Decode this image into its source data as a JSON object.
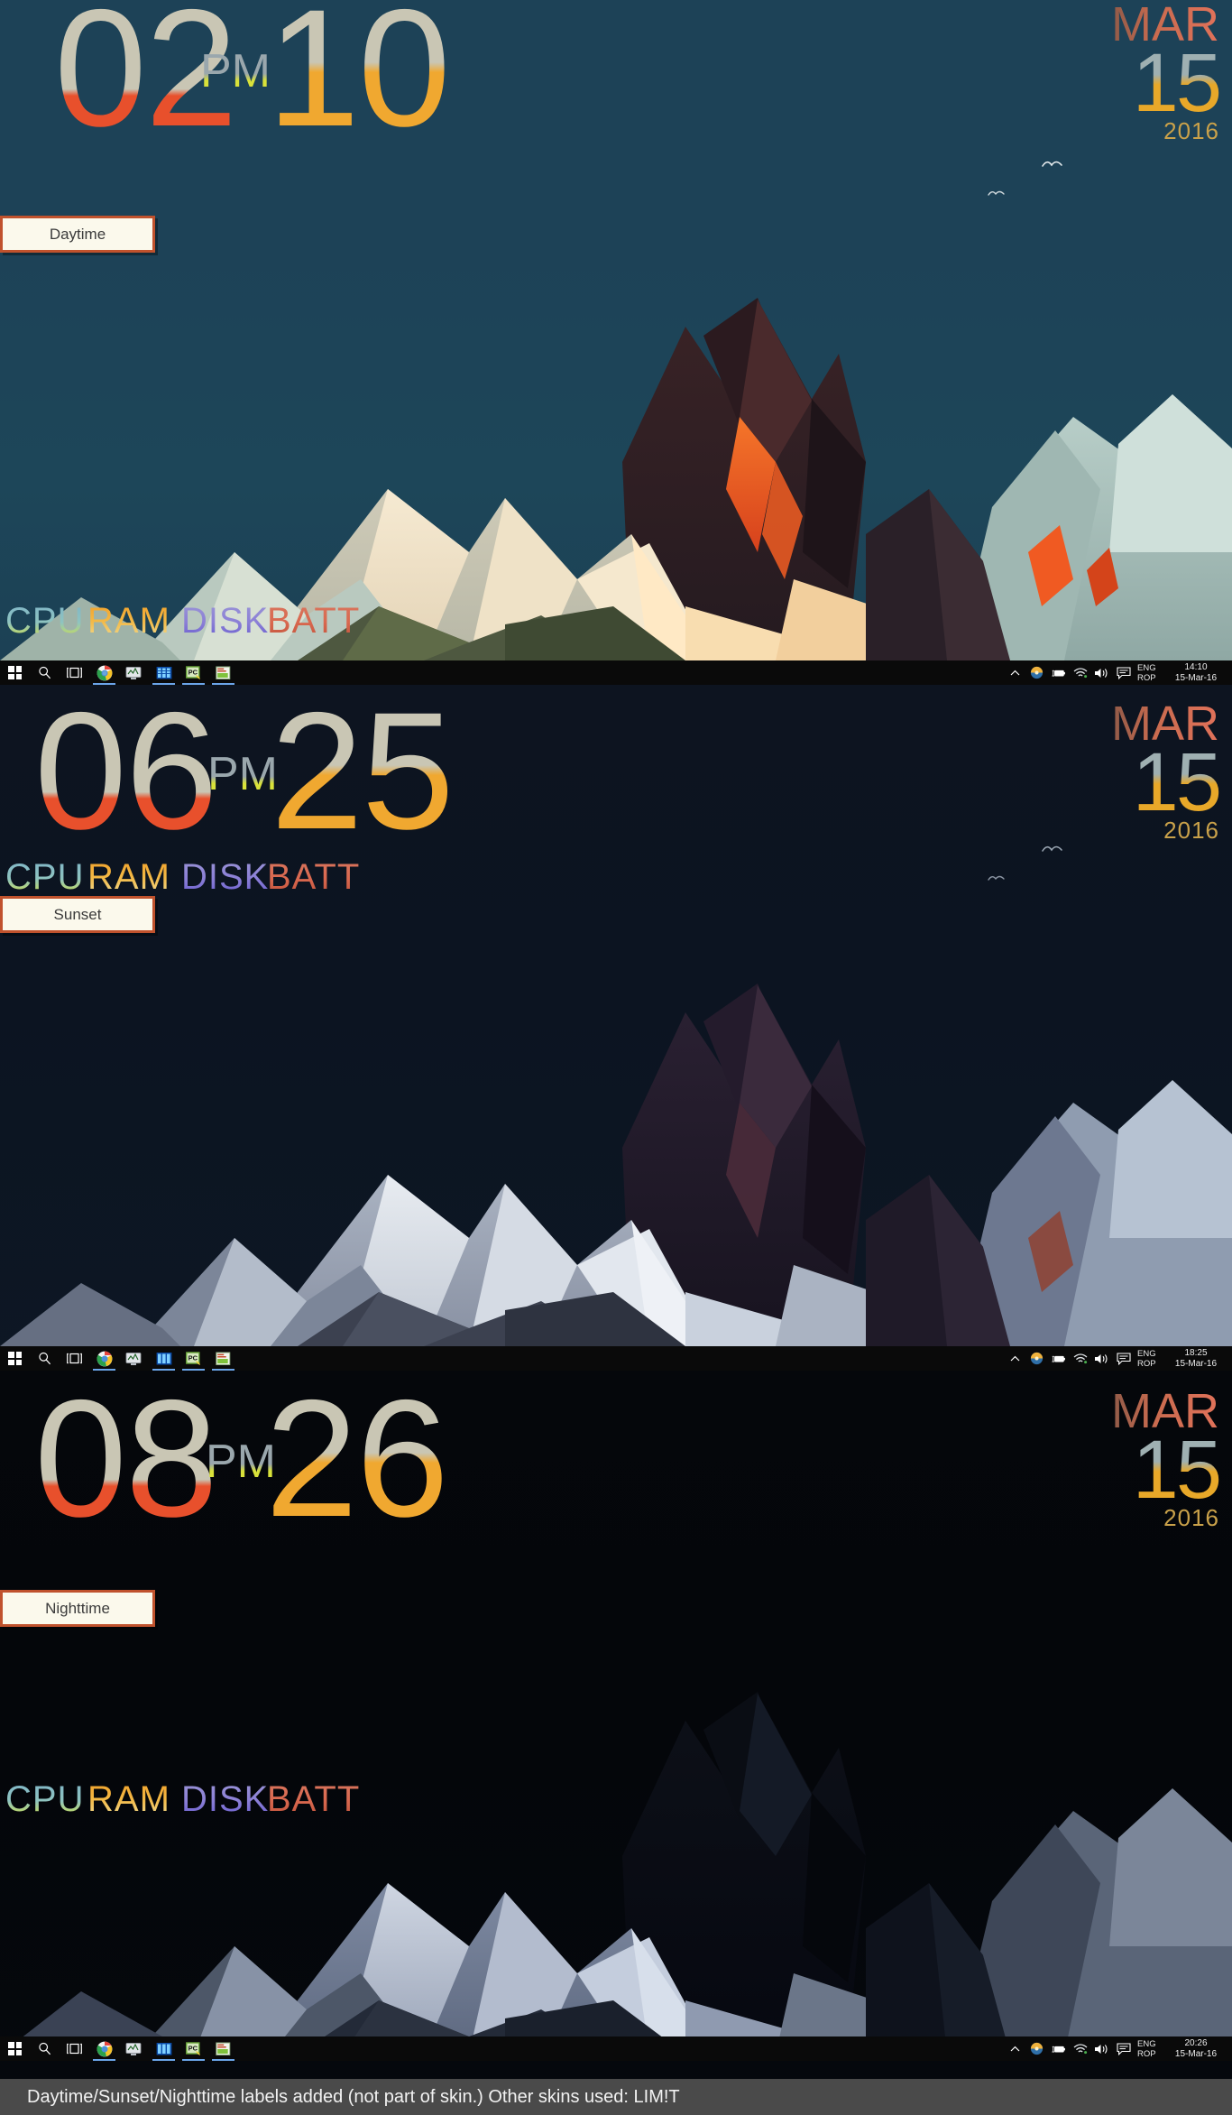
{
  "caption": {
    "text": "Daytime/Sunset/Nighttime labels added (not part of skin.) Other skins used: LIM!T"
  },
  "colors": {
    "accent_red": "#e8502c",
    "accent_gold": "#f0a830",
    "accent_cream": "#c9c6b4",
    "accent_yellow": "#d9e23a",
    "accent_purple": "#8b7fd6",
    "label_border": "#c0522d",
    "label_bg": "#fbf9ec",
    "sky_day": "#1d4257",
    "sky_sunset": "#0d1420",
    "sky_night": "#05070b"
  },
  "panels": [
    {
      "name": "daytime",
      "annotation": "Daytime",
      "clock": {
        "hour": "02",
        "ampm": "PM",
        "minute": "10"
      },
      "date": {
        "month": "MAR",
        "day": "15",
        "year": "2016"
      },
      "meters": {
        "cpu": "CPU",
        "ram": "RAM",
        "disk": "DISK",
        "batt": "BATT"
      },
      "taskbar": {
        "language_line1": "ENG",
        "language_line2": "ROP",
        "time": "14:10",
        "date": "15-Mar-16",
        "icons": [
          "start-icon",
          "search-icon",
          "task-view-icon",
          "chrome-icon",
          "monitor-icon",
          "task-manager-icon",
          "pc-icon",
          "chart-app-icon"
        ],
        "tray_icons": [
          "chevron-up-icon",
          "weather-icon",
          "battery-icon",
          "wifi-icon",
          "volume-icon",
          "action-center-icon"
        ]
      }
    },
    {
      "name": "sunset",
      "annotation": "Sunset",
      "clock": {
        "hour": "06",
        "ampm": "PM",
        "minute": "25"
      },
      "date": {
        "month": "MAR",
        "day": "15",
        "year": "2016"
      },
      "meters": {
        "cpu": "CPU",
        "ram": "RAM",
        "disk": "DISK",
        "batt": "BATT"
      },
      "taskbar": {
        "language_line1": "ENG",
        "language_line2": "ROP",
        "time": "18:25",
        "date": "15-Mar-16",
        "icons": [
          "start-icon",
          "search-icon",
          "task-view-icon",
          "chrome-icon",
          "monitor-icon",
          "task-manager-icon",
          "pc-icon",
          "chart-app-icon"
        ],
        "tray_icons": [
          "chevron-up-icon",
          "weather-icon",
          "battery-icon",
          "wifi-icon",
          "volume-icon",
          "action-center-icon"
        ]
      }
    },
    {
      "name": "nighttime",
      "annotation": "Nighttime",
      "clock": {
        "hour": "08",
        "ampm": "PM",
        "minute": "26"
      },
      "date": {
        "month": "MAR",
        "day": "15",
        "year": "2016"
      },
      "meters": {
        "cpu": "CPU",
        "ram": "RAM",
        "disk": "DISK",
        "batt": "BATT"
      },
      "taskbar": {
        "language_line1": "ENG",
        "language_line2": "ROP",
        "time": "20:26",
        "date": "15-Mar-16",
        "icons": [
          "start-icon",
          "search-icon",
          "task-view-icon",
          "chrome-icon",
          "monitor-icon",
          "task-manager-icon",
          "pc-icon",
          "chart-app-icon"
        ],
        "tray_icons": [
          "chevron-up-icon",
          "weather-icon",
          "battery-icon",
          "wifi-icon",
          "volume-icon",
          "action-center-icon"
        ]
      }
    }
  ]
}
